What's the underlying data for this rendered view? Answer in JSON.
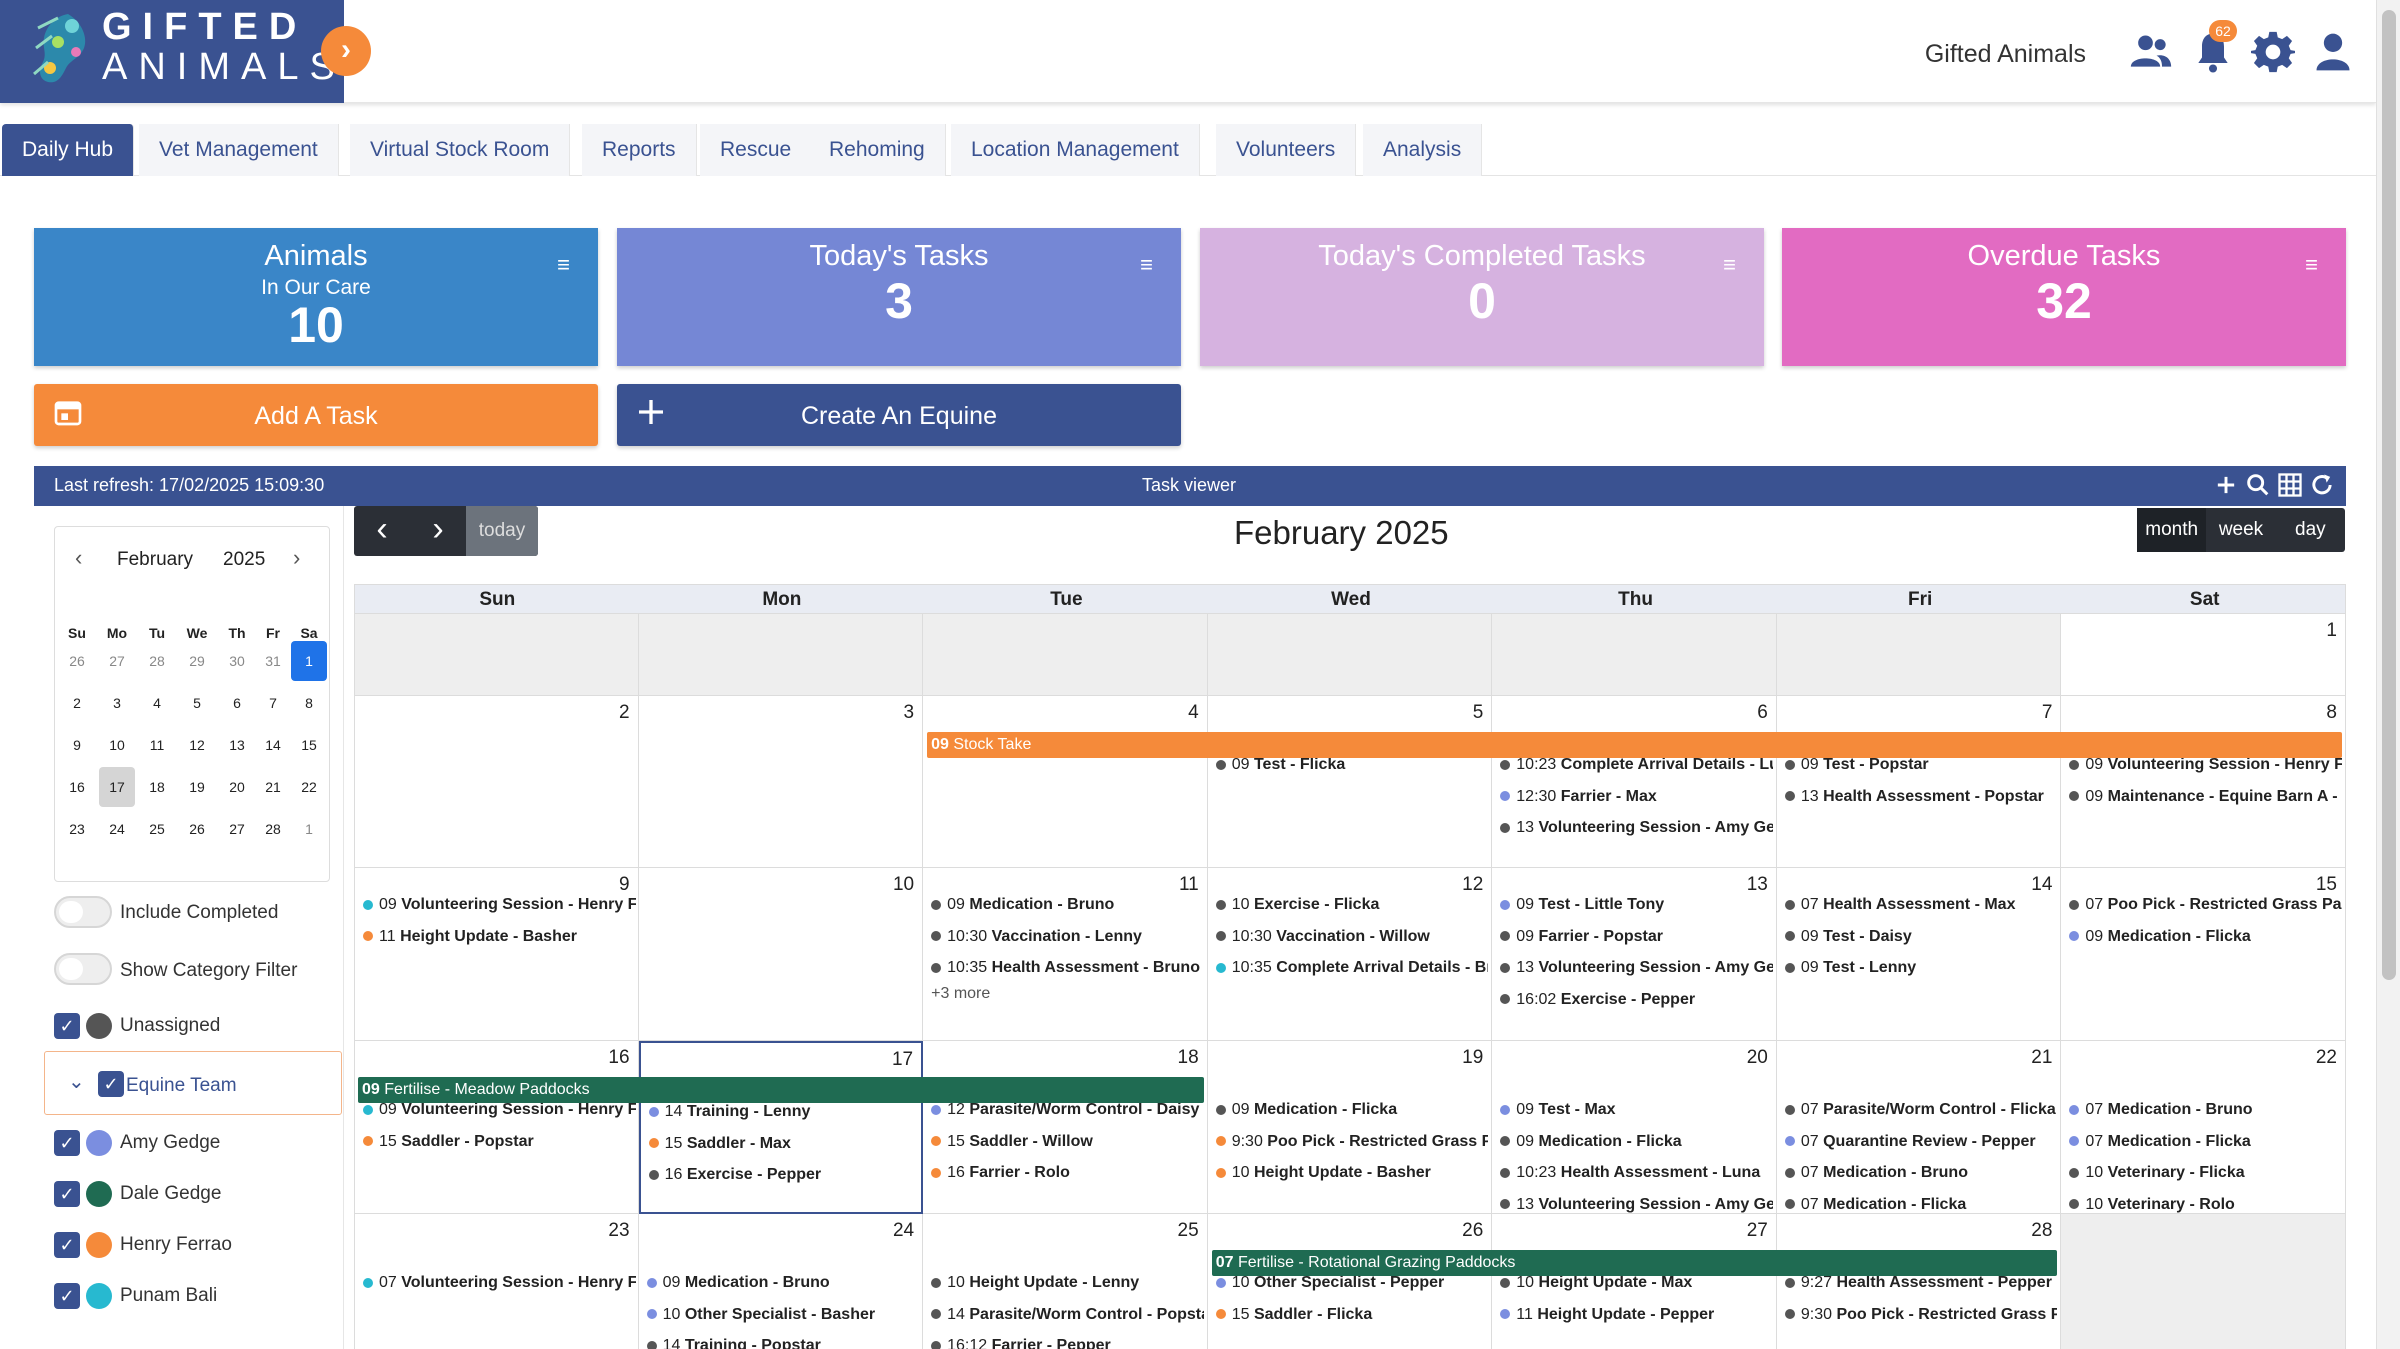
{
  "header": {
    "logo_line1": "GIFTED",
    "logo_line2": "ANIMALS",
    "org_name": "Gifted Animals",
    "notification_count": "62",
    "icons": [
      "users-icon",
      "bell-icon",
      "gear-icon",
      "user-icon"
    ]
  },
  "tabs": [
    {
      "label": "Daily Hub",
      "active": true
    },
    {
      "label": "Vet Management"
    },
    {
      "label": "Virtual Stock Room"
    },
    {
      "label": "Reports"
    },
    {
      "label": "Rescue"
    },
    {
      "label": "Rehoming"
    },
    {
      "label": "Location Management"
    },
    {
      "label": "Volunteers"
    },
    {
      "label": "Analysis"
    }
  ],
  "cards": {
    "animals": {
      "title": "Animals",
      "subtitle": "In Our Care",
      "value": "10",
      "color": "#3a86c8"
    },
    "today": {
      "title": "Today's Tasks",
      "value": "3",
      "color": "#7587d5"
    },
    "completed": {
      "title": "Today's Completed Tasks",
      "value": "0",
      "color": "#d6b2e0"
    },
    "overdue": {
      "title": "Overdue Tasks",
      "value": "32",
      "color": "#e26bc2"
    }
  },
  "buttons": {
    "add_task": "Add A Task",
    "create_equine": "Create An Equine"
  },
  "task_viewer": {
    "last_refresh": "Last refresh: 17/02/2025 15:09:30",
    "title": "Task viewer"
  },
  "mini_calendar": {
    "month": "February",
    "year": "2025",
    "dow": [
      "Su",
      "Mo",
      "Tu",
      "We",
      "Th",
      "Fr",
      "Sa"
    ],
    "weeks": [
      [
        "26",
        "27",
        "28",
        "29",
        "30",
        "31",
        "1"
      ],
      [
        "2",
        "3",
        "4",
        "5",
        "6",
        "7",
        "8"
      ],
      [
        "9",
        "10",
        "11",
        "12",
        "13",
        "14",
        "15"
      ],
      [
        "16",
        "17",
        "18",
        "19",
        "20",
        "21",
        "22"
      ],
      [
        "23",
        "24",
        "25",
        "26",
        "27",
        "28",
        "1"
      ]
    ]
  },
  "filters": {
    "include_completed": "Include Completed",
    "show_category": "Show Category Filter",
    "unassigned": "Unassigned",
    "team": "Equine Team",
    "members": [
      {
        "name": "Amy Gedge",
        "color": "#7b8ee0"
      },
      {
        "name": "Dale Gedge",
        "color": "#1f6b52"
      },
      {
        "name": "Henry Ferrao",
        "color": "#f58a3a"
      },
      {
        "name": "Punam Bali",
        "color": "#27b9d0"
      }
    ]
  },
  "calendar": {
    "title": "February 2025",
    "today_label": "today",
    "views": [
      "month",
      "week",
      "day"
    ],
    "days_of_week": [
      "Sun",
      "Mon",
      "Tue",
      "Wed",
      "Thu",
      "Fri",
      "Sat"
    ],
    "weeks": [
      {
        "days": [
          {
            "n": "",
            "out": true,
            "events": []
          },
          {
            "n": "",
            "out": true,
            "events": []
          },
          {
            "n": "",
            "out": true,
            "events": []
          },
          {
            "n": "",
            "out": true,
            "events": []
          },
          {
            "n": "",
            "out": true,
            "events": []
          },
          {
            "n": "",
            "out": true,
            "events": []
          },
          {
            "n": "1",
            "events": []
          }
        ]
      },
      {
        "bars": [
          {
            "start": 2,
            "span": 5,
            "time": "09",
            "label": "Stock Take",
            "color": "#f58a3a"
          }
        ],
        "days": [
          {
            "n": "2",
            "events": []
          },
          {
            "n": "3",
            "events": []
          },
          {
            "n": "4",
            "events": []
          },
          {
            "n": "5",
            "events": [
              {
                "c": "#555",
                "t": "09",
                "l": "Test - Flicka"
              }
            ]
          },
          {
            "n": "6",
            "events": [
              {
                "c": "#555",
                "t": "10:23",
                "l": "Complete Arrival Details - Luna"
              },
              {
                "c": "#7b8ee0",
                "t": "12:30",
                "l": "Farrier - Max"
              },
              {
                "c": "#555",
                "t": "13",
                "l": "Volunteering Session - Amy Gedge"
              }
            ]
          },
          {
            "n": "7",
            "events": [
              {
                "c": "#555",
                "t": "09",
                "l": "Test - Popstar"
              },
              {
                "c": "#555",
                "t": "13",
                "l": "Health Assessment - Popstar"
              }
            ]
          },
          {
            "n": "8",
            "events": [
              {
                "c": "#555",
                "t": "09",
                "l": "Volunteering Session - Henry Ferrao"
              },
              {
                "c": "#555",
                "t": "09",
                "l": "Maintenance - Equine Barn A - "
              }
            ]
          }
        ]
      },
      {
        "days": [
          {
            "n": "9",
            "events": [
              {
                "c": "#27b9d0",
                "t": "09",
                "l": "Volunteering Session - Henry Ferrao"
              },
              {
                "c": "#f58a3a",
                "t": "11",
                "l": "Height Update - Basher"
              }
            ]
          },
          {
            "n": "10",
            "events": []
          },
          {
            "n": "11",
            "events": [
              {
                "c": "#555",
                "t": "09",
                "l": "Medication - Bruno"
              },
              {
                "c": "#555",
                "t": "10:30",
                "l": "Vaccination - Lenny"
              },
              {
                "c": "#555",
                "t": "10:35",
                "l": "Health Assessment - Bruno"
              }
            ],
            "more": "+3 more"
          },
          {
            "n": "12",
            "events": [
              {
                "c": "#555",
                "t": "10",
                "l": "Exercise - Flicka"
              },
              {
                "c": "#555",
                "t": "10:30",
                "l": "Vaccination - Willow"
              },
              {
                "c": "#27b9d0",
                "t": "10:35",
                "l": "Complete Arrival Details - Bruno"
              }
            ]
          },
          {
            "n": "13",
            "events": [
              {
                "c": "#7b8ee0",
                "t": "09",
                "l": "Test - Little Tony"
              },
              {
                "c": "#555",
                "t": "09",
                "l": "Farrier - Popstar"
              },
              {
                "c": "#555",
                "t": "13",
                "l": "Volunteering Session - Amy Gedge"
              },
              {
                "c": "#555",
                "t": "16:02",
                "l": "Exercise - Pepper"
              }
            ]
          },
          {
            "n": "14",
            "events": [
              {
                "c": "#555",
                "t": "07",
                "l": "Health Assessment - Max"
              },
              {
                "c": "#555",
                "t": "09",
                "l": "Test - Daisy"
              },
              {
                "c": "#555",
                "t": "09",
                "l": "Test - Lenny"
              }
            ]
          },
          {
            "n": "15",
            "events": [
              {
                "c": "#555",
                "t": "07",
                "l": "Poo Pick - Restricted Grass Paddock"
              },
              {
                "c": "#7b8ee0",
                "t": "09",
                "l": "Medication - Flicka"
              }
            ]
          }
        ]
      },
      {
        "bars": [
          {
            "start": 0,
            "span": 3,
            "time": "09",
            "label": "Fertilise - Meadow Paddocks",
            "color": "#1f6b52"
          }
        ],
        "days": [
          {
            "n": "16",
            "events": [
              {
                "c": "#27b9d0",
                "t": "09",
                "l": "Volunteering Session - Henry Ferrao"
              },
              {
                "c": "#f58a3a",
                "t": "15",
                "l": "Saddler - Popstar"
              }
            ]
          },
          {
            "n": "17",
            "today": true,
            "events": [
              {
                "c": "#7b8ee0",
                "t": "14",
                "l": "Training - Lenny"
              },
              {
                "c": "#f58a3a",
                "t": "15",
                "l": "Saddler - Max"
              },
              {
                "c": "#555",
                "t": "16",
                "l": "Exercise - Pepper"
              }
            ]
          },
          {
            "n": "18",
            "events": [
              {
                "c": "#7b8ee0",
                "t": "12",
                "l": "Parasite/Worm Control - Daisy"
              },
              {
                "c": "#f58a3a",
                "t": "15",
                "l": "Saddler - Willow"
              },
              {
                "c": "#f58a3a",
                "t": "16",
                "l": "Farrier - Rolo"
              }
            ]
          },
          {
            "n": "19",
            "events": [
              {
                "c": "#555",
                "t": "09",
                "l": "Medication - Flicka"
              },
              {
                "c": "#f58a3a",
                "t": "9:30",
                "l": "Poo Pick - Restricted Grass Paddock"
              },
              {
                "c": "#f58a3a",
                "t": "10",
                "l": "Height Update - Basher"
              }
            ]
          },
          {
            "n": "20",
            "events": [
              {
                "c": "#7b8ee0",
                "t": "09",
                "l": "Test - Max"
              },
              {
                "c": "#555",
                "t": "09",
                "l": "Medication - Flicka"
              },
              {
                "c": "#555",
                "t": "10:23",
                "l": "Health Assessment - Luna"
              },
              {
                "c": "#555",
                "t": "13",
                "l": "Volunteering Session - Amy Gedge"
              }
            ]
          },
          {
            "n": "21",
            "events": [
              {
                "c": "#555",
                "t": "07",
                "l": "Parasite/Worm Control - Flicka"
              },
              {
                "c": "#7b8ee0",
                "t": "07",
                "l": "Quarantine Review - Pepper"
              },
              {
                "c": "#555",
                "t": "07",
                "l": "Medication - Bruno"
              },
              {
                "c": "#555",
                "t": "07",
                "l": "Medication - Flicka"
              }
            ]
          },
          {
            "n": "22",
            "events": [
              {
                "c": "#7b8ee0",
                "t": "07",
                "l": "Medication - Bruno"
              },
              {
                "c": "#7b8ee0",
                "t": "07",
                "l": "Medication - Flicka"
              },
              {
                "c": "#555",
                "t": "10",
                "l": "Veterinary - Flicka"
              },
              {
                "c": "#555",
                "t": "10",
                "l": "Veterinary - Rolo"
              }
            ]
          }
        ]
      },
      {
        "bars": [
          {
            "start": 3,
            "span": 3,
            "time": "07",
            "label": "Fertilise - Rotational Grazing Paddocks",
            "color": "#1f6b52"
          }
        ],
        "days": [
          {
            "n": "23",
            "events": [
              {
                "c": "#27b9d0",
                "t": "07",
                "l": "Volunteering Session - Henry Ferrao"
              }
            ]
          },
          {
            "n": "24",
            "events": [
              {
                "c": "#7b8ee0",
                "t": "09",
                "l": "Medication - Bruno"
              },
              {
                "c": "#7b8ee0",
                "t": "10",
                "l": "Other Specialist - Basher"
              },
              {
                "c": "#555",
                "t": "14",
                "l": "Training - Popstar"
              }
            ]
          },
          {
            "n": "25",
            "events": [
              {
                "c": "#555",
                "t": "10",
                "l": "Height Update - Lenny"
              },
              {
                "c": "#555",
                "t": "14",
                "l": "Parasite/Worm Control - Popstar"
              },
              {
                "c": "#555",
                "t": "16:12",
                "l": "Farrier - Pepper"
              }
            ]
          },
          {
            "n": "26",
            "events": [
              {
                "c": "#7b8ee0",
                "t": "10",
                "l": "Other Specialist - Pepper"
              },
              {
                "c": "#f58a3a",
                "t": "15",
                "l": "Saddler - Flicka"
              }
            ]
          },
          {
            "n": "27",
            "events": [
              {
                "c": "#555",
                "t": "10",
                "l": "Height Update - Max"
              },
              {
                "c": "#7b8ee0",
                "t": "11",
                "l": "Height Update - Pepper"
              }
            ]
          },
          {
            "n": "28",
            "events": [
              {
                "c": "#555",
                "t": "9:27",
                "l": "Health Assessment - Pepper"
              },
              {
                "c": "#555",
                "t": "9:30",
                "l": "Poo Pick - Restricted Grass Paddock"
              }
            ]
          },
          {
            "n": "",
            "out": true,
            "events": []
          }
        ]
      }
    ]
  }
}
